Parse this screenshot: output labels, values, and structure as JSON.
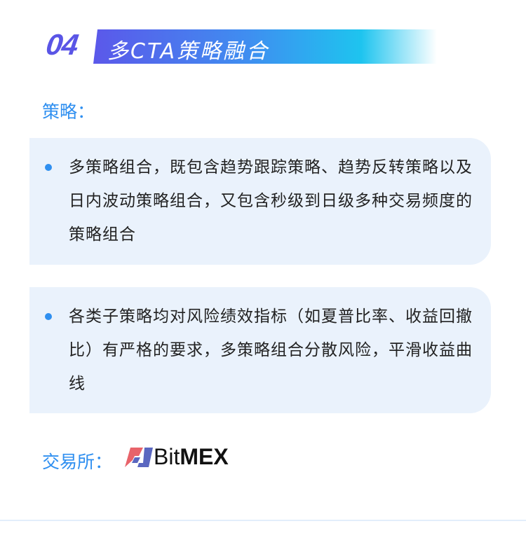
{
  "section": {
    "number": "04",
    "title": "多CTA策略融合"
  },
  "strategy_label": "策略：",
  "items": [
    "多策略组合，既包含趋势跟踪策略、趋势反转策略以及日内波动策略组合，又包含秒级到日级多种交易频度的策略组合",
    "各类子策略均对风险绩效指标（如夏普比率、收益回撤比）有严格的要求，多策略组合分散风险，平滑收益曲线"
  ],
  "exchange_label": "交易所：",
  "exchange": {
    "name_light": "Bit",
    "name_bold": "MEX"
  },
  "colors": {
    "accent": "#2f8ff0",
    "card": "#eaf2fc",
    "number": "#5a55e6"
  }
}
